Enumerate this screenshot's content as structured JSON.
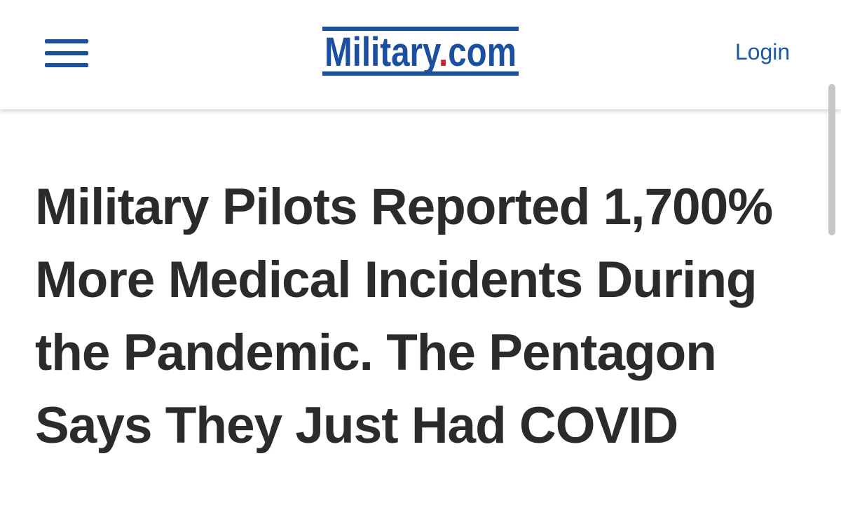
{
  "header": {
    "menu_icon": "hamburger-menu-icon",
    "logo": {
      "text_main": "Military",
      "text_domain": "com",
      "alt": "Military.com"
    },
    "login_label": "Login"
  },
  "article": {
    "headline": "Military Pilots Reported 1,700% More Medical Incidents During the Pandemic. The Pentagon Says They Just Had COVID"
  },
  "colors": {
    "brand_blue": "#1b4fa0",
    "brand_red": "#d0202e",
    "text_dark": "#2b2b2b",
    "link_blue": "#1a5aa6"
  }
}
